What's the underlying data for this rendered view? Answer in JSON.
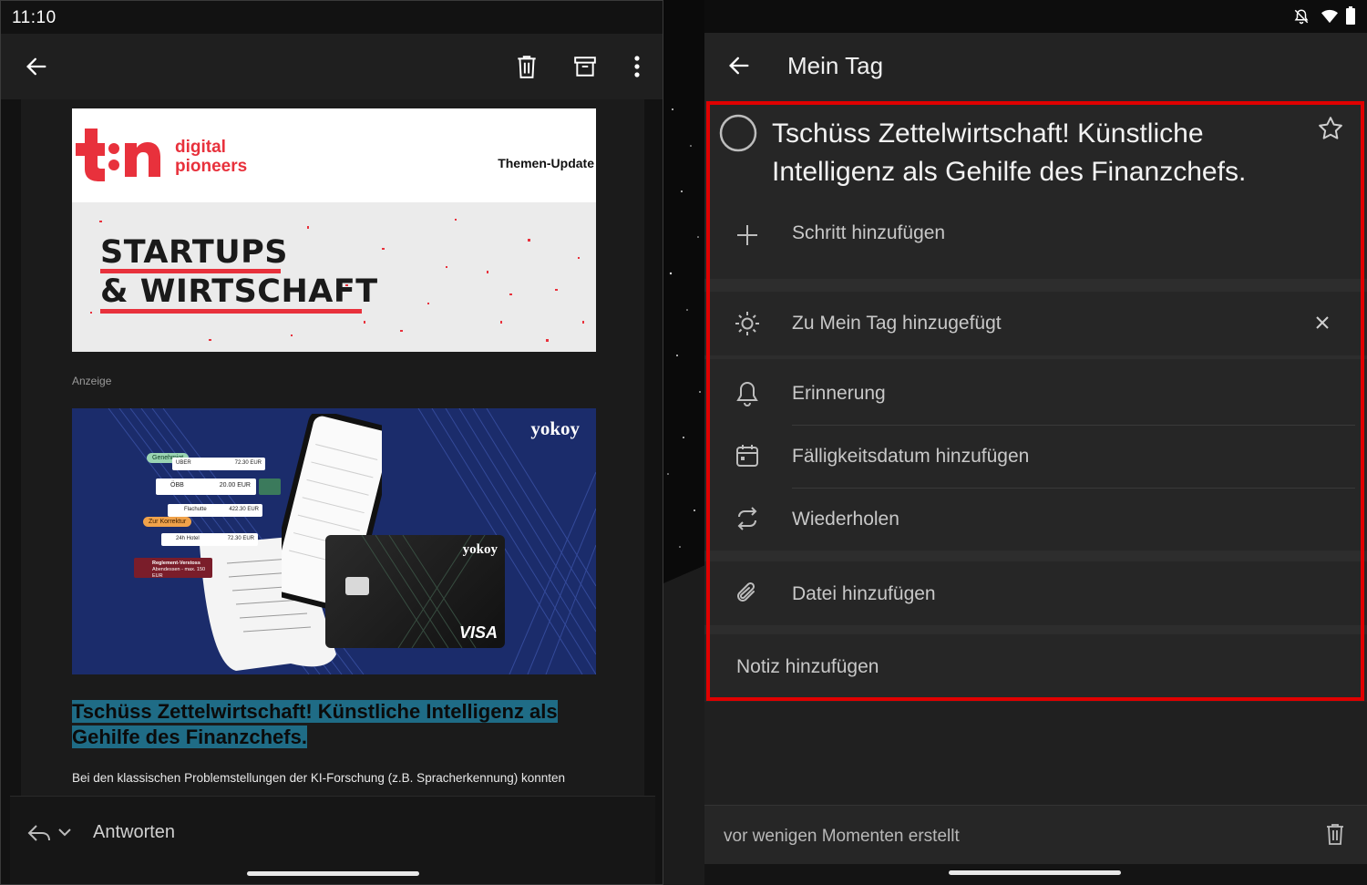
{
  "status_left": {
    "time": "11:10"
  },
  "mail": {
    "toolbar": {
      "back_icon": "arrow-left-icon",
      "delete_icon": "trash-icon",
      "archive_icon": "archive-icon",
      "more_icon": "more-vertical-icon"
    },
    "banner": {
      "brand_name_line1": "digital",
      "brand_name_line2": "pioneers",
      "themen": "Themen-Update",
      "headline_line1": "STARTUPS",
      "headline_line2": "& WIRTSCHAFT"
    },
    "ad_label": "Anzeige",
    "ad": {
      "brand": "yokoy",
      "card_brand": "yokoy",
      "card_network": "VISA",
      "badge_genehmigt": "Genehmigt",
      "badge_korrektur": "Zur Korrektur",
      "warning_title": "Reglement-Verstoss",
      "warning_text": "Abendessen - max. 150 EUR",
      "tile_obb": "ÖBB",
      "tile_obb_amount": "20.00 EUR",
      "tile_uber": "UBER",
      "tile_uber_amount": "72.30 EUR",
      "tile_hotel": "24h Hotel",
      "tile_hotel_amount": "72.30 EUR",
      "tile_4": "Flachutte",
      "tile_4_amount": "422.30 EUR"
    },
    "headline_line1": "Tschüss Zettelwirtschaft! Künstliche Intelligenz als",
    "headline_line2": "Gehilfe des Finanzchefs.",
    "body": "Bei den klassischen Problemstellungen der KI-Forschung (z.B. Spracherkennung) konnten",
    "reply": {
      "label": "Antworten",
      "icon": "reply-icon",
      "chevron": "chevron-down-icon"
    }
  },
  "todo": {
    "header": {
      "back_icon": "arrow-left-icon",
      "title": "Mein Tag"
    },
    "task": {
      "title": "Tschüss Zettelwirtschaft! Künstliche Intelligenz als Gehilfe des Finanzchefs.",
      "complete_icon": "circle-icon",
      "star_icon": "star-icon"
    },
    "add_step": "Schritt hinzufügen",
    "my_day": "Zu Mein Tag hinzugefügt",
    "reminder": "Erinnerung",
    "due_date": "Fälligkeitsdatum hinzufügen",
    "repeat": "Wiederholen",
    "add_file": "Datei hinzufügen",
    "note_placeholder": "Notiz hinzufügen",
    "footer": "vor wenigen Momenten erstellt"
  }
}
